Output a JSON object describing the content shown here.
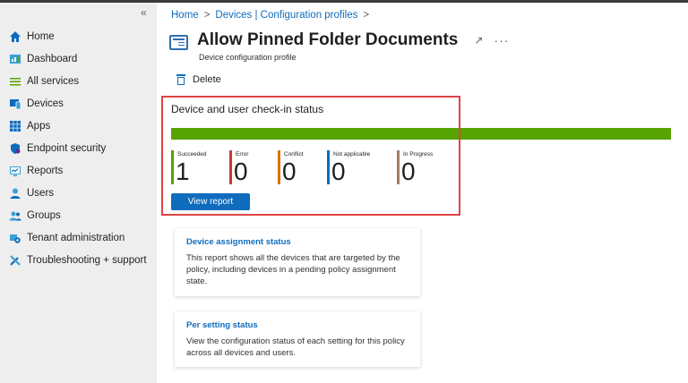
{
  "sidebar": {
    "collapse": "«",
    "items": [
      {
        "label": "Home",
        "icon": "home-icon"
      },
      {
        "label": "Dashboard",
        "icon": "dashboard-icon"
      },
      {
        "label": "All services",
        "icon": "list-icon"
      },
      {
        "label": "Devices",
        "icon": "devices-icon"
      },
      {
        "label": "Apps",
        "icon": "apps-icon"
      },
      {
        "label": "Endpoint security",
        "icon": "shield-icon"
      },
      {
        "label": "Reports",
        "icon": "reports-icon"
      },
      {
        "label": "Users",
        "icon": "user-icon"
      },
      {
        "label": "Groups",
        "icon": "groups-icon"
      },
      {
        "label": "Tenant administration",
        "icon": "tenant-gear-icon"
      },
      {
        "label": "Troubleshooting + support",
        "icon": "tools-icon"
      }
    ]
  },
  "breadcrumb": {
    "home": "Home",
    "sep": ">",
    "devices": "Devices | Configuration profiles"
  },
  "header": {
    "title": "Allow Pinned Folder Documents",
    "pin": "↗",
    "more": "···",
    "subtitle": "Device configuration profile"
  },
  "toolbar": {
    "delete_label": "Delete"
  },
  "checkin": {
    "title": "Device and user check-in status",
    "progress_color": "#57a300",
    "stats": [
      {
        "label": "Succeeded",
        "value": "1",
        "color": "#57a300"
      },
      {
        "label": "Error",
        "value": "0",
        "color": "#d13438"
      },
      {
        "label": "Conflict",
        "value": "0",
        "color": "#d47500"
      },
      {
        "label": "Not applicable",
        "value": "0",
        "color": "#0f6cbd"
      },
      {
        "label": "In Progress",
        "value": "0",
        "color": "#a57c63"
      }
    ],
    "view_report": "View report"
  },
  "cards": [
    {
      "title": "Device assignment status",
      "desc": "This report shows all the devices that are targeted by the policy, including devices in a pending policy assignment state."
    },
    {
      "title": "Per setting status",
      "desc": "View the configuration status of each setting for this policy across all devices and users."
    }
  ]
}
